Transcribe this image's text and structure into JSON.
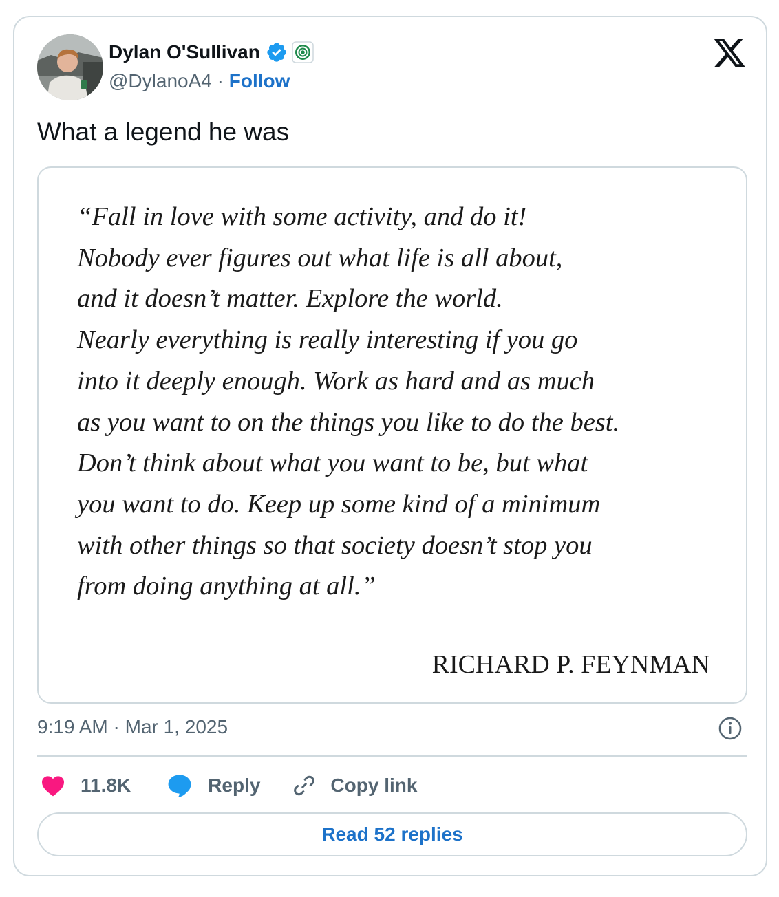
{
  "author": {
    "display_name": "Dylan O'Sullivan",
    "handle": "@DylanoA4",
    "separator": " · ",
    "follow_label": "Follow",
    "avatar_icon": "profile-photo",
    "verified_icon": "verified-badge-icon",
    "affiliate_icon": "concentric-circles-badge-icon"
  },
  "platform_logo": "x-logo-icon",
  "tweet": {
    "text": "What a legend he was",
    "timestamp": "9:19 AM · Mar 1, 2025"
  },
  "media": {
    "quote_lines": [
      "“Fall in love with some activity, and do it!",
      "Nobody ever figures out what life is all about,",
      "and it doesn’t matter. Explore the world.",
      "Nearly everything is really interesting if you go",
      "into it deeply enough. Work as hard and as much",
      "as you want to on the things you like to do the best.",
      "Don’t think about what you want to be, but what",
      "you want to do. Keep up some kind of a minimum",
      "with other things so that society doesn’t stop you",
      "from doing anything at all.”"
    ],
    "attribution": "RICHARD P. FEYNMAN"
  },
  "actions": {
    "like_count": "11.8K",
    "reply_label": "Reply",
    "copy_link_label": "Copy link",
    "read_replies_label": "Read 52 replies"
  },
  "colors": {
    "text_primary": "#0f1419",
    "text_secondary": "#536471",
    "link_blue": "#1d72c9",
    "heart_pink": "#f91880",
    "reply_blue": "#1d9bf0",
    "border": "#cfd9de"
  }
}
